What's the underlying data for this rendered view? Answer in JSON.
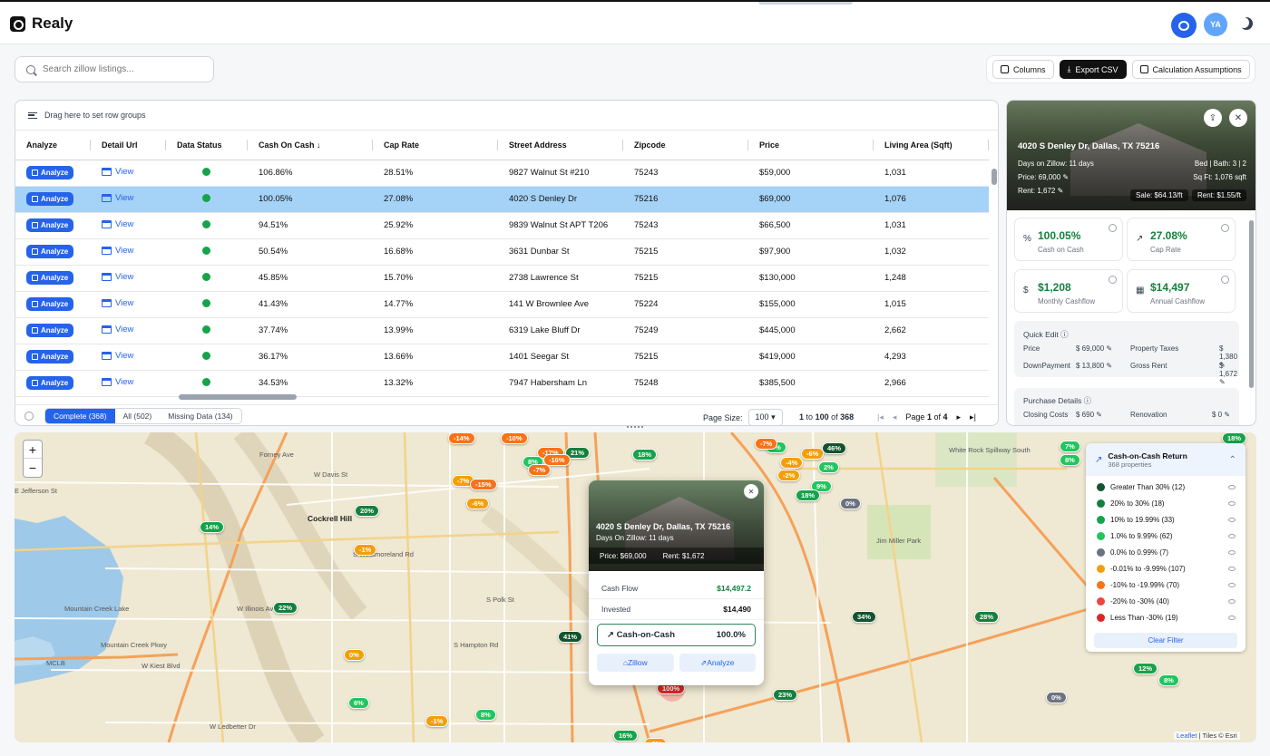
{
  "app": {
    "title": "Realy",
    "avatar": "YA"
  },
  "search": {
    "placeholder": "Search zillow listings..."
  },
  "toolbar": {
    "columns": "Columns",
    "export": "Export CSV",
    "assumptions": "Calculation Assumptions"
  },
  "grid": {
    "group_hint": "Drag here to set row groups",
    "columns": [
      "Analyze",
      "Detail Url",
      "Data Status",
      "Cash On Cash",
      "Cap Rate",
      "Street Address",
      "Zipcode",
      "Price",
      "Living Area (Sqft)"
    ],
    "analyze_label": "Analyze",
    "view_label": "View",
    "rows": [
      {
        "coc": "106.86%",
        "cap": "28.51%",
        "addr": "9827 Walnut St #210",
        "zip": "75243",
        "price": "$59,000",
        "area": "1,031"
      },
      {
        "coc": "100.05%",
        "cap": "27.08%",
        "addr": "4020 S Denley Dr",
        "zip": "75216",
        "price": "$69,000",
        "area": "1,076"
      },
      {
        "coc": "94.51%",
        "cap": "25.92%",
        "addr": "9839 Walnut St APT T206",
        "zip": "75243",
        "price": "$66,500",
        "area": "1,031"
      },
      {
        "coc": "50.54%",
        "cap": "16.68%",
        "addr": "3631 Dunbar St",
        "zip": "75215",
        "price": "$97,900",
        "area": "1,032"
      },
      {
        "coc": "45.85%",
        "cap": "15.70%",
        "addr": "2738 Lawrence St",
        "zip": "75215",
        "price": "$130,000",
        "area": "1,248"
      },
      {
        "coc": "41.43%",
        "cap": "14.77%",
        "addr": "141 W Brownlee Ave",
        "zip": "75224",
        "price": "$155,000",
        "area": "1,015"
      },
      {
        "coc": "37.74%",
        "cap": "13.99%",
        "addr": "6319 Lake Bluff Dr",
        "zip": "75249",
        "price": "$445,000",
        "area": "2,662"
      },
      {
        "coc": "36.17%",
        "cap": "13.66%",
        "addr": "1401 Seegar St",
        "zip": "75215",
        "price": "$419,000",
        "area": "4,293"
      },
      {
        "coc": "34.53%",
        "cap": "13.32%",
        "addr": "7947 Habersham Ln",
        "zip": "75248",
        "price": "$385,500",
        "area": "2,966"
      }
    ],
    "selected_row": 1,
    "filters": [
      "Complete (368)",
      "All (502)",
      "Missing Data (134)"
    ],
    "page_size_label": "Page Size:",
    "page_size": "100",
    "range_from": "1",
    "range_to": "100",
    "range_total": "368",
    "range_to_word": "to",
    "range_of_word": "of",
    "page_word": "Page",
    "page_current": "1",
    "page_of": "of",
    "page_total": "4"
  },
  "detail": {
    "title": "4020 S Denley Dr, Dallas, TX 75216",
    "days": "Days on Zillow: 11 days",
    "bedbath": "Bed | Bath: 3 | 2",
    "price": "Price: 69,000",
    "sqft": "Sq Ft: 1,076 sqft",
    "rent": "Rent: 1,672",
    "sale_psf": "Sale: $64.13/ft",
    "rent_psf": "Rent: $1.55/ft",
    "metrics": [
      {
        "value": "100.05%",
        "label": "Cash on Cash",
        "icon": "%"
      },
      {
        "value": "27.08%",
        "label": "Cap Rate",
        "icon": "↗"
      },
      {
        "value": "$1,208",
        "label": "Monthly Cashflow",
        "icon": "$"
      },
      {
        "value": "$14,497",
        "label": "Annual Cashflow",
        "icon": "▦"
      }
    ],
    "quick_edit": "Quick Edit",
    "qe": [
      {
        "k": "Price",
        "v": "$ 69,000"
      },
      {
        "k": "Property Taxes",
        "v": "$ 1,380"
      },
      {
        "k": "DownPayment",
        "v": "$ 13,800"
      },
      {
        "k": "Gross Rent",
        "v": "$ 1,672"
      }
    ],
    "purchase_details": "Purchase Details",
    "pd": [
      {
        "k": "Closing Costs",
        "v": "$ 690"
      },
      {
        "k": "Renovation",
        "v": "$ 0"
      }
    ]
  },
  "popup": {
    "title": "4020 S Denley Dr, Dallas, TX 75216",
    "days": "Days On Zillow: 11 days",
    "price": "Price: $69,000",
    "rent": "Rent: $1,672",
    "cash_flow_label": "Cash Flow",
    "cash_flow": "$14,497.2",
    "invested_label": "Invested",
    "invested": "$14,490",
    "coc_label": "Cash-on-Cash",
    "coc": "100.0%",
    "zillow": "Zillow",
    "analyze": "Analyze"
  },
  "legend": {
    "title": "Cash-on-Cash Return",
    "subtitle": "368 properties",
    "items": [
      {
        "label": "Greater Than 30% (12)",
        "color": "#14532d"
      },
      {
        "label": "20% to 30% (18)",
        "color": "#15803d"
      },
      {
        "label": "10% to 19.99% (33)",
        "color": "#16a34a"
      },
      {
        "label": "1.0% to 9.99% (62)",
        "color": "#22c55e"
      },
      {
        "label": "0.0% to 0.99% (7)",
        "color": "#6b7280"
      },
      {
        "label": "-0.01% to -9.99% (107)",
        "color": "#f59e0b"
      },
      {
        "label": "-10% to -19.99% (70)",
        "color": "#f97316"
      },
      {
        "label": "-20% to -30% (40)",
        "color": "#ef4444"
      },
      {
        "label": "Less Than -30% (19)",
        "color": "#dc2626"
      }
    ],
    "clear": "Clear Filter"
  },
  "map": {
    "zoom_in": "+",
    "zoom_out": "−",
    "attribution_link": "Leaflet",
    "attribution_rest": "| Tiles © Esri",
    "places": [
      "Cockrell Hill",
      "Mountain Creek Lake",
      "White Rock Spillway South",
      "Jim Miller Park",
      "W Davis St",
      "E Jefferson St",
      "W Illinois Ave",
      "W Kiest Blvd",
      "W Ledbetter Dr",
      "MCLB",
      "Mountain Creek Pkwy",
      "S Westmoreland Rd",
      "S Hampton Rd",
      "S Polk St",
      "Forney Ave"
    ],
    "markers": [
      {
        "t": "14%",
        "c": "#16a34a"
      },
      {
        "t": "20%",
        "c": "#15803d"
      },
      {
        "t": "22%",
        "c": "#15803d"
      },
      {
        "t": "-1%",
        "c": "#f59e0b"
      },
      {
        "t": "0%",
        "c": "#f59e0b"
      },
      {
        "t": "6%",
        "c": "#22c55e"
      },
      {
        "t": "-1%",
        "c": "#f59e0b"
      },
      {
        "t": "8%",
        "c": "#22c55e"
      },
      {
        "t": "41%",
        "c": "#14532d"
      },
      {
        "t": "-7%",
        "c": "#f59e0b"
      },
      {
        "t": "-15%",
        "c": "#f97316"
      },
      {
        "t": "-6%",
        "c": "#f59e0b"
      },
      {
        "t": "-14%",
        "c": "#f97316"
      },
      {
        "t": "-10%",
        "c": "#f97316"
      },
      {
        "t": "-17%",
        "c": "#f97316"
      },
      {
        "t": "21%",
        "c": "#15803d"
      },
      {
        "t": "8%",
        "c": "#22c55e"
      },
      {
        "t": "-16%",
        "c": "#f97316"
      },
      {
        "t": "-7%",
        "c": "#f97316"
      },
      {
        "t": "18%",
        "c": "#16a34a"
      },
      {
        "t": "4%",
        "c": "#22c55e"
      },
      {
        "t": "-6%",
        "c": "#f59e0b"
      },
      {
        "t": "46%",
        "c": "#14532d"
      },
      {
        "t": "-4%",
        "c": "#f59e0b"
      },
      {
        "t": "2%",
        "c": "#22c55e"
      },
      {
        "t": "-2%",
        "c": "#f59e0b"
      },
      {
        "t": "9%",
        "c": "#22c55e"
      },
      {
        "t": "18%",
        "c": "#16a34a"
      },
      {
        "t": "0%",
        "c": "#6b7280"
      },
      {
        "t": "34%",
        "c": "#14532d"
      },
      {
        "t": "28%",
        "c": "#15803d"
      },
      {
        "t": "23%",
        "c": "#15803d"
      },
      {
        "t": "100%",
        "c": "#dc2626"
      },
      {
        "t": "16%",
        "c": "#16a34a"
      },
      {
        "t": "0%",
        "c": "#6b7280"
      },
      {
        "t": "7%",
        "c": "#22c55e"
      },
      {
        "t": "8%",
        "c": "#22c55e"
      },
      {
        "t": "18%",
        "c": "#16a34a"
      },
      {
        "t": "12%",
        "c": "#16a34a"
      },
      {
        "t": "8%",
        "c": "#22c55e"
      },
      {
        "t": "-7%",
        "c": "#f97316"
      },
      {
        "t": "-8%",
        "c": "#f59e0b"
      }
    ]
  }
}
